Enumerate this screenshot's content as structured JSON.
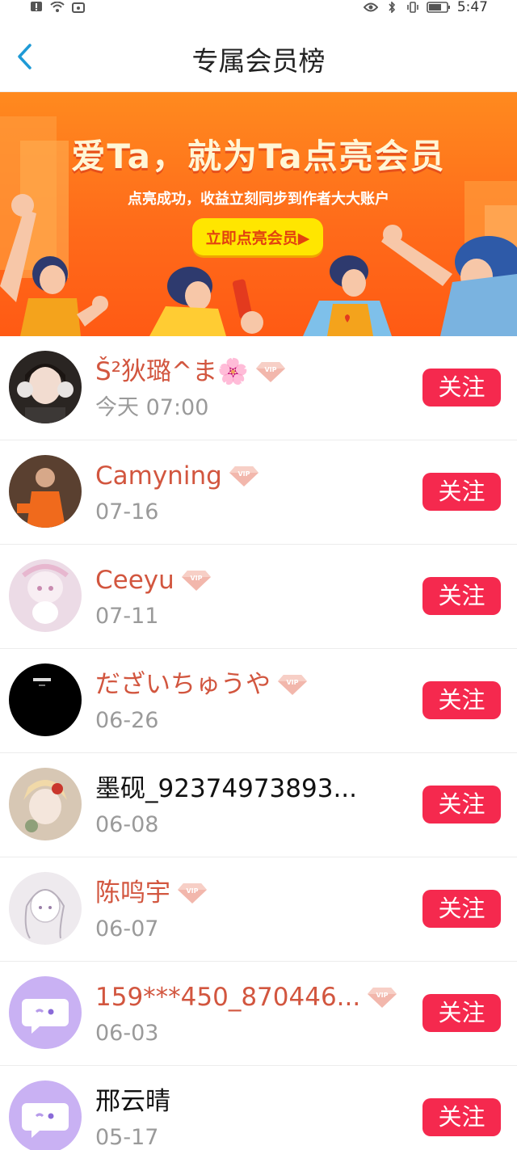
{
  "status_bar": {
    "time": "5:47"
  },
  "header": {
    "title": "专属会员榜",
    "back_icon": "chevron-left-icon"
  },
  "banner": {
    "title": "爱Ta，就为Ta点亮会员",
    "subtitle": "点亮成功，收益立刻同步到作者大大账户",
    "button_label": "立即点亮会员▶"
  },
  "members": [
    {
      "name": "Š²狄璐^ま🌸",
      "date": "今天 07:00",
      "vip": true,
      "follow_label": "关注",
      "avatar": "photo-girl-headphones",
      "avatar_color": "#2a2522"
    },
    {
      "name": "Camyning",
      "date": "07-16",
      "vip": true,
      "follow_label": "关注",
      "avatar": "photo-orange-outfit",
      "avatar_color": "#5a4030"
    },
    {
      "name": "Ceeyu",
      "date": "07-11",
      "vip": true,
      "follow_label": "关注",
      "avatar": "anime-pink",
      "avatar_color": "#e9d3df"
    },
    {
      "name": "だざいちゅうや",
      "date": "06-26",
      "vip": true,
      "follow_label": "关注",
      "avatar": "black-text-avatar",
      "avatar_color": "#000000"
    },
    {
      "name": "墨砚_92374973893...",
      "date": "06-08",
      "vip": false,
      "follow_label": "关注",
      "avatar": "anime-floral",
      "avatar_color": "#d7c7b4"
    },
    {
      "name": "陈鸣宇",
      "date": "06-07",
      "vip": true,
      "follow_label": "关注",
      "avatar": "anime-sketch",
      "avatar_color": "#ece8ec"
    },
    {
      "name": "159***450_870446...",
      "date": "06-03",
      "vip": true,
      "follow_label": "关注",
      "avatar": "default-chat-avatar",
      "avatar_color": "#c9b1f3"
    },
    {
      "name": "邢云晴",
      "date": "05-17",
      "vip": false,
      "follow_label": "关注",
      "avatar": "default-chat-avatar",
      "avatar_color": "#c9b1f3"
    }
  ],
  "colors": {
    "name_vip": "#d2563f",
    "follow_button": "#f5294e",
    "date": "#9a9a9a",
    "banner_orange": "#ff6b1a"
  }
}
